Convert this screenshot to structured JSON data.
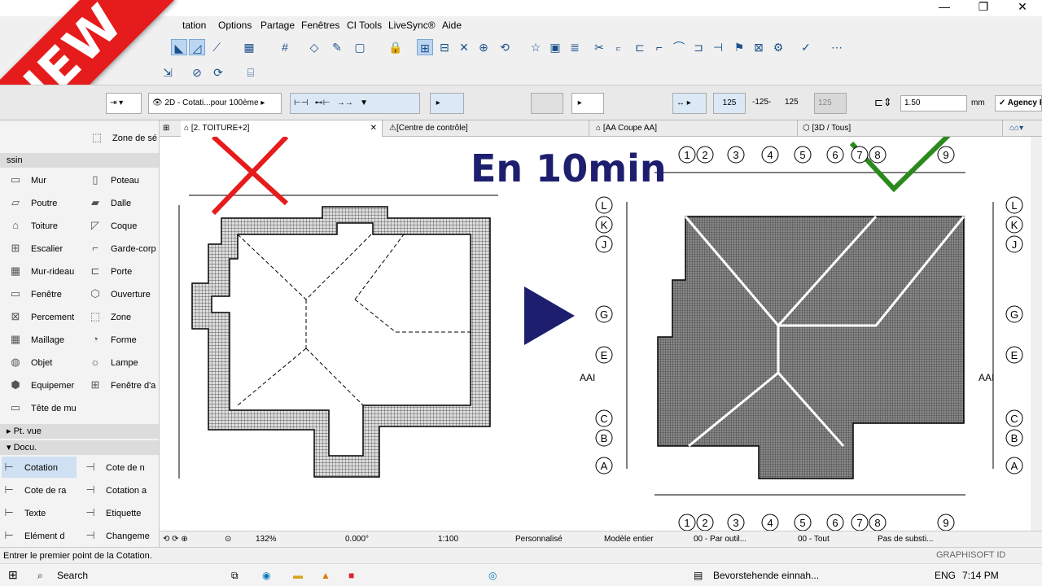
{
  "colors": {
    "accent": "#1a4f8a",
    "ribbon": "#e61c1c",
    "headline": "#1d1f6e",
    "cross": "#e61c1c",
    "check": "#2a8a1c",
    "arrow": "#1d1f6e"
  },
  "ribbon": {
    "text": "NEW"
  },
  "headline": "En 10min",
  "menu": [
    "tation",
    "Options",
    "Partage",
    "Fenêtres",
    "CI Tools",
    "LiveSync®",
    "Aide"
  ],
  "window_controls": {
    "minimize": "—",
    "restore": "❐",
    "close": "✕"
  },
  "infobox": {
    "layer": "2D - Cotati...pour 100ème",
    "precision_a": "125",
    "precision_b": "-125-",
    "precision_c": "125",
    "precision_d": "125",
    "value": "1.50",
    "unit": "mm",
    "font": "Agency F"
  },
  "toolbox": {
    "top_items": [
      {
        "label": "Zone de sé",
        "icon": "zone-icon"
      }
    ],
    "section_design": "ssin",
    "design_tools": [
      {
        "l": "Mur",
        "r": "Poteau"
      },
      {
        "l": "Poutre",
        "r": "Dalle"
      },
      {
        "l": "Toiture",
        "r": "Coque"
      },
      {
        "l": "Escalier",
        "r": "Garde-corp"
      },
      {
        "l": "Mur-rideau",
        "r": "Porte"
      },
      {
        "l": "Fenêtre",
        "r": "Ouverture"
      },
      {
        "l": "Percement",
        "r": "Zone"
      },
      {
        "l": "Maillage",
        "r": "Forme"
      },
      {
        "l": "Objet",
        "r": "Lampe"
      },
      {
        "l": "Equipemer",
        "r": "Fenêtre d'a"
      },
      {
        "l": "Tête de mu",
        "r": ""
      }
    ],
    "section_view": "Pt. vue",
    "section_doc": "Docu.",
    "doc_tools": [
      {
        "l": "Cotation",
        "r": "Cote de n"
      },
      {
        "l": "Cote de ra",
        "r": "Cotation a"
      },
      {
        "l": "Texte",
        "r": "Etiquette"
      },
      {
        "l": "Elément d",
        "r": "Changeme"
      }
    ]
  },
  "tabs": [
    "[2. TOITURE+2]",
    "[Centre de contrôle]",
    "[AA Coupe AA]",
    "[3D / Tous]"
  ],
  "tab_close": "✕",
  "status": {
    "zoom": "132%",
    "angle": "0.000°",
    "scale": "1:100",
    "pen": "Personnalisé",
    "model": "Modèle entier",
    "layer": "00 - Par outil...",
    "view": "00 - Tout",
    "subst": "Pas de substi..."
  },
  "message": "Entrer le premier point de la Cotation.",
  "brand": "GRAPHISOFT ID",
  "taskbar": {
    "search": "Search",
    "notification": "Bevorstehende einnah...",
    "lang": "ENG",
    "time": "7:14 PM"
  },
  "drawing": {
    "grid_top": [
      "1",
      "2",
      "3",
      "4",
      "5",
      "6",
      "7",
      "8",
      "9"
    ],
    "grid_side": [
      "L",
      "K",
      "J",
      "G",
      "E",
      "C",
      "B",
      "A"
    ],
    "section": "AAI"
  }
}
